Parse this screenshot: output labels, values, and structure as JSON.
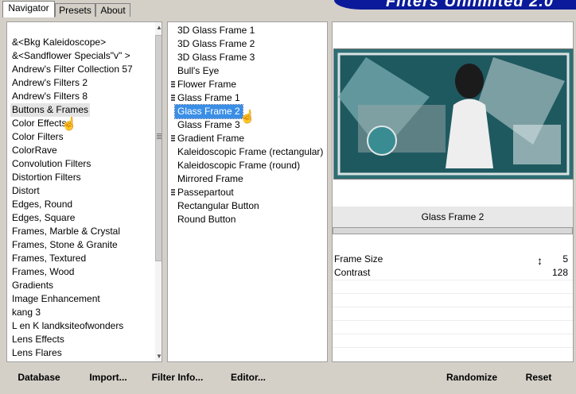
{
  "tabs": [
    "Navigator",
    "Presets",
    "About"
  ],
  "banner_title": "Filters Unlimited 2.0",
  "categories": [
    "&<Bkg Kaleidoscope>",
    "&<Sandflower Specials\"v\" >",
    "Andrew's Filter Collection 57",
    "Andrew's Filters 2",
    "Andrew's Filters 8",
    "Buttons & Frames",
    "Color Effects",
    "Color Filters",
    "ColorRave",
    "Convolution Filters",
    "Distortion Filters",
    "Distort",
    "Edges, Round",
    "Edges, Square",
    "Frames, Marble & Crystal",
    "Frames, Stone & Granite",
    "Frames, Textured",
    "Frames, Wood",
    "Gradients",
    "Image Enhancement",
    "kang 3",
    "L en K landksiteofwonders",
    "Lens Effects",
    "Lens Flares"
  ],
  "selected_category": "Buttons & Frames",
  "filters": [
    "3D Glass Frame 1",
    "3D Glass Frame 2",
    "3D Glass Frame 3",
    "Bull's Eye",
    "Flower Frame",
    "Glass Frame 1",
    "Glass Frame 2",
    "Glass Frame 3",
    "Gradient Frame",
    "Kaleidoscopic Frame (rectangular)",
    "Kaleidoscopic Frame (round)",
    "Mirrored Frame",
    "Passepartout",
    "Rectangular Button",
    "Round Button"
  ],
  "selected_filter": "Glass Frame 2",
  "filter_name": "Glass Frame 2",
  "params": [
    {
      "label": "Frame Size",
      "value": "5"
    },
    {
      "label": "Contrast",
      "value": "128"
    }
  ],
  "buttons": {
    "database": "Database",
    "import": "Import...",
    "filter_info": "Filter Info...",
    "editor": "Editor...",
    "randomize": "Randomize",
    "reset": "Reset"
  },
  "icons": {
    "cursor": "hand-pointer-icon",
    "resize": "vertical-resize-icon",
    "scroll_up": "scroll-up-arrow-icon",
    "scroll_down": "scroll-down-arrow-icon"
  },
  "colors": {
    "selection": "#3a8ee6",
    "banner": "#0a1a9a",
    "preview_teal": "#1f6a73"
  }
}
